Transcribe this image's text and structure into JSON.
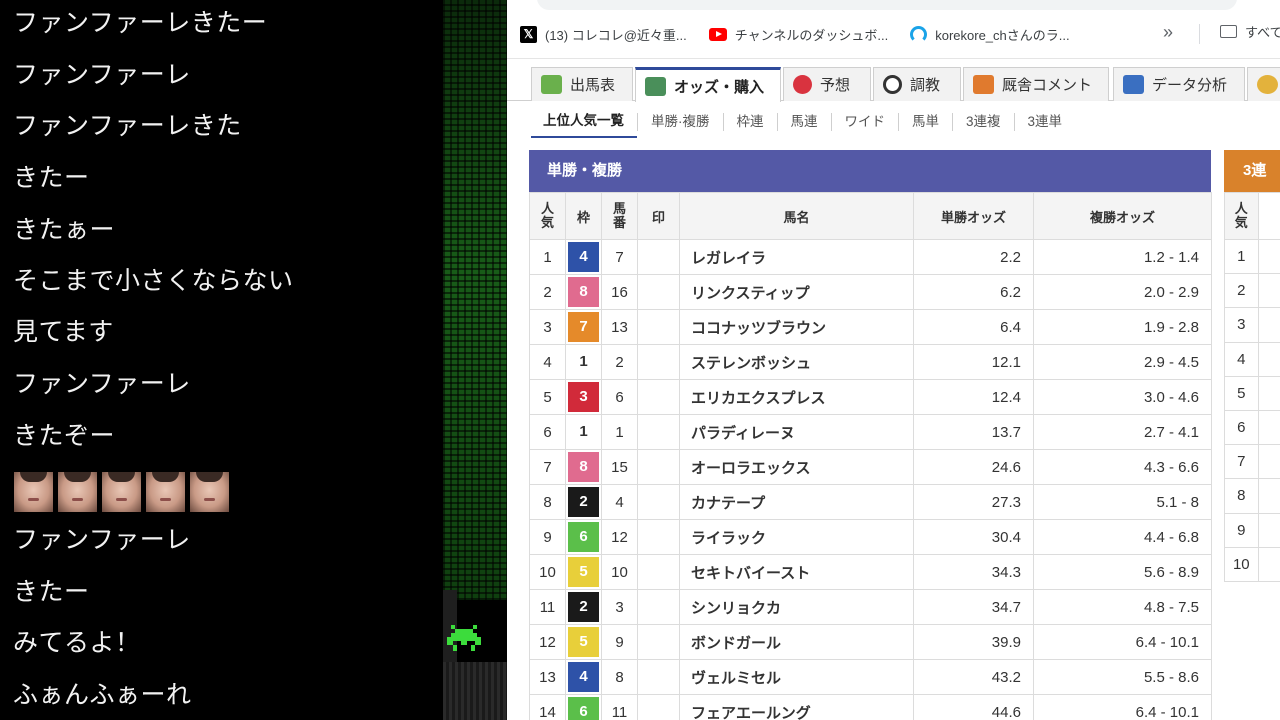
{
  "chat": {
    "lines": [
      "ファンファーレきたー",
      "ファンファーレ",
      "ファンファーレきた",
      "きたー",
      "きたぁー",
      "そこまで小さくならない",
      "見てます",
      "ファンファーレ",
      "きたぞー",
      "",
      "ファンファーレ",
      "きたー",
      "みてるよ！",
      "ふぁんふぁーれ"
    ],
    "emote_count": 5
  },
  "bookmarks": {
    "items": [
      {
        "icon": "x-icon",
        "label": "(13) コレコレ@近々重..."
      },
      {
        "icon": "youtube-icon",
        "label": "チャンネルのダッシュボ..."
      },
      {
        "icon": "live-icon",
        "label": "korekore_chさんのラ..."
      }
    ],
    "more": "»",
    "folder_label": "すべて"
  },
  "tabs": [
    {
      "label": "出馬表",
      "color": "#6ab04c"
    },
    {
      "label": "オッズ・購入",
      "color": "#4a8f5a"
    },
    {
      "label": "予想",
      "color": "#d9333f"
    },
    {
      "label": "調教",
      "color": "#333333"
    },
    {
      "label": "厩舎コメント",
      "color": "#e07a2e"
    },
    {
      "label": "データ分析",
      "color": "#3a6fc1"
    }
  ],
  "subtabs": [
    "上位人気一覧",
    "単勝·複勝",
    "枠連",
    "馬連",
    "ワイド",
    "馬単",
    "3連複",
    "3連単"
  ],
  "odds_table": {
    "title": "単勝・複勝",
    "headers": {
      "rank": "人\n気",
      "waku": "枠",
      "num": "馬\n番",
      "mark": "印",
      "name": "馬名",
      "win": "単勝オッズ",
      "place": "複勝オッズ"
    },
    "waku_colors": {
      "1": {
        "bg": "#ffffff",
        "fg": "#333333"
      },
      "2": {
        "bg": "#1a1a1a",
        "fg": "#ffffff"
      },
      "3": {
        "bg": "#d12a3a",
        "fg": "#ffffff"
      },
      "4": {
        "bg": "#2e52a8",
        "fg": "#ffffff"
      },
      "5": {
        "bg": "#e8cf3a",
        "fg": "#ffffff"
      },
      "6": {
        "bg": "#5bbf4a",
        "fg": "#ffffff"
      },
      "7": {
        "bg": "#e58a2a",
        "fg": "#ffffff"
      },
      "8": {
        "bg": "#e06b8f",
        "fg": "#ffffff"
      }
    },
    "rows": [
      {
        "rank": "1",
        "waku": "4",
        "num": "7",
        "name": "レガレイラ",
        "win": "2.2",
        "place": "1.2 - 1.4",
        "win_hot": true,
        "place_hot": true
      },
      {
        "rank": "2",
        "waku": "8",
        "num": "16",
        "name": "リンクスティップ",
        "win": "6.2",
        "place": "2.0 - 2.9",
        "win_hot": true,
        "place_hot": true
      },
      {
        "rank": "3",
        "waku": "7",
        "num": "13",
        "name": "ココナッツブラウン",
        "win": "6.4",
        "place": "1.9 - 2.8",
        "win_hot": true,
        "place_hot": true
      },
      {
        "rank": "4",
        "waku": "1",
        "num": "2",
        "name": "ステレンボッシュ",
        "win": "12.1",
        "place": "2.9 - 4.5",
        "win_hot": false,
        "place_hot": true
      },
      {
        "rank": "5",
        "waku": "3",
        "num": "6",
        "name": "エリカエクスプレス",
        "win": "12.4",
        "place": "3.0 - 4.6",
        "win_hot": false,
        "place_hot": true
      },
      {
        "rank": "6",
        "waku": "1",
        "num": "1",
        "name": "パラディレーヌ",
        "win": "13.7",
        "place": "2.7 - 4.1",
        "win_hot": false,
        "place_hot": true
      },
      {
        "rank": "7",
        "waku": "8",
        "num": "15",
        "name": "オーロラエックス",
        "win": "24.6",
        "place": "4.3 - 6.6",
        "win_hot": false,
        "place_hot": true
      },
      {
        "rank": "8",
        "waku": "2",
        "num": "4",
        "name": "カナテープ",
        "win": "27.3",
        "place": "5.1 - 8",
        "win_hot": false,
        "place_hot": true
      },
      {
        "rank": "9",
        "waku": "6",
        "num": "12",
        "name": "ライラック",
        "win": "30.4",
        "place": "4.4 - 6.8",
        "win_hot": false,
        "place_hot": true
      },
      {
        "rank": "10",
        "waku": "5",
        "num": "10",
        "name": "セキトバイースト",
        "win": "34.3",
        "place": "5.6 - 8.9",
        "win_hot": false,
        "place_hot": true
      },
      {
        "rank": "11",
        "waku": "2",
        "num": "3",
        "name": "シンリョクカ",
        "win": "34.7",
        "place": "4.8 - 7.5",
        "win_hot": false,
        "place_hot": true
      },
      {
        "rank": "12",
        "waku": "5",
        "num": "9",
        "name": "ボンドガール",
        "win": "39.9",
        "place": "6.4 - 10.1",
        "win_hot": false,
        "place_hot": false
      },
      {
        "rank": "13",
        "waku": "4",
        "num": "8",
        "name": "ヴェルミセル",
        "win": "43.2",
        "place": "5.5 - 8.6",
        "win_hot": false,
        "place_hot": true
      },
      {
        "rank": "14",
        "waku": "6",
        "num": "11",
        "name": "フェアエールング",
        "win": "44.6",
        "place": "6.4 - 10.1",
        "win_hot": false,
        "place_hot": false
      }
    ]
  },
  "side_table": {
    "title": "3連",
    "header": "人\n気",
    "ranks": [
      "1",
      "2",
      "3",
      "4",
      "5",
      "6",
      "7",
      "8",
      "9",
      "10"
    ]
  }
}
